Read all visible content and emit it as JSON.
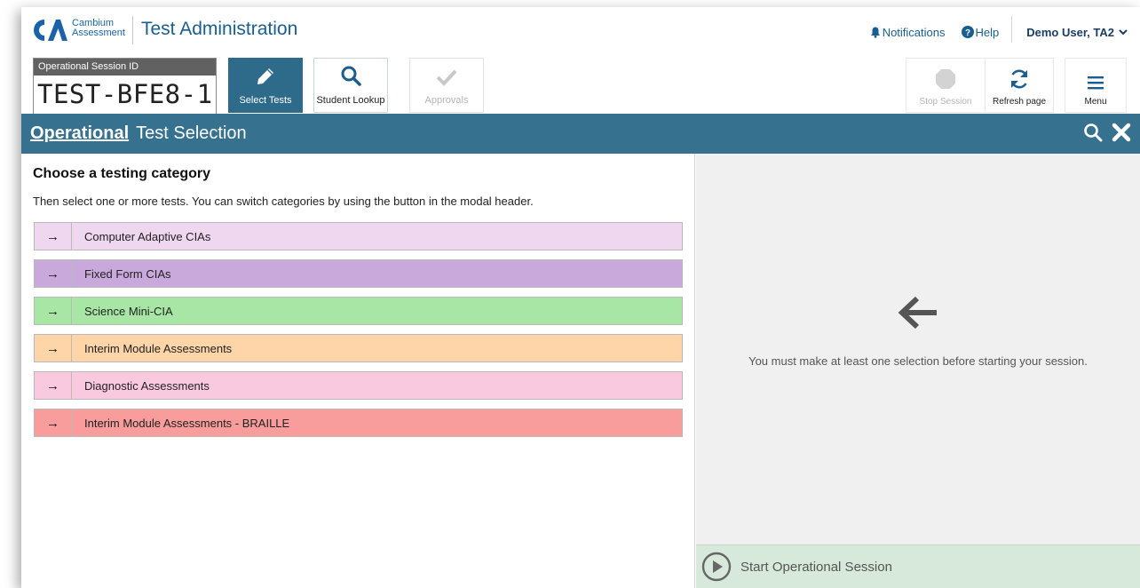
{
  "app": {
    "brand_line1": "Cambium",
    "brand_line2": "Assessment",
    "title": "Test Administration"
  },
  "topnav": {
    "notifications": "Notifications",
    "help": "Help",
    "user": "Demo User, TA2"
  },
  "session": {
    "label": "Operational Session ID",
    "id": "TEST-BFE8-1"
  },
  "toolbar": {
    "select_tests": "Select Tests",
    "student_lookup": "Student Lookup",
    "approvals": "Approvals",
    "stop_session": "Stop Session",
    "refresh_page": "Refresh page",
    "menu": "Menu"
  },
  "modal": {
    "category": "Operational",
    "title": "Test Selection"
  },
  "left": {
    "heading": "Choose a testing category",
    "description": "Then select one or more tests. You can switch categories by using the button in the modal header.",
    "categories": [
      {
        "label": "Computer Adaptive CIAs",
        "color": "#f0d7f0"
      },
      {
        "label": "Fixed Form CIAs",
        "color": "#c9a9dc"
      },
      {
        "label": "Science Mini-CIA",
        "color": "#a8e6a5"
      },
      {
        "label": "Interim Module Assessments",
        "color": "#fdd5a8"
      },
      {
        "label": "Diagnostic Assessments",
        "color": "#f9c9e0"
      },
      {
        "label": "Interim Module Assessments - BRAILLE",
        "color": "#f89c9c"
      }
    ],
    "arrow_glyph": "→"
  },
  "right": {
    "message": "You must make at least one selection before starting your session.",
    "start_label": "Start Operational Session"
  }
}
